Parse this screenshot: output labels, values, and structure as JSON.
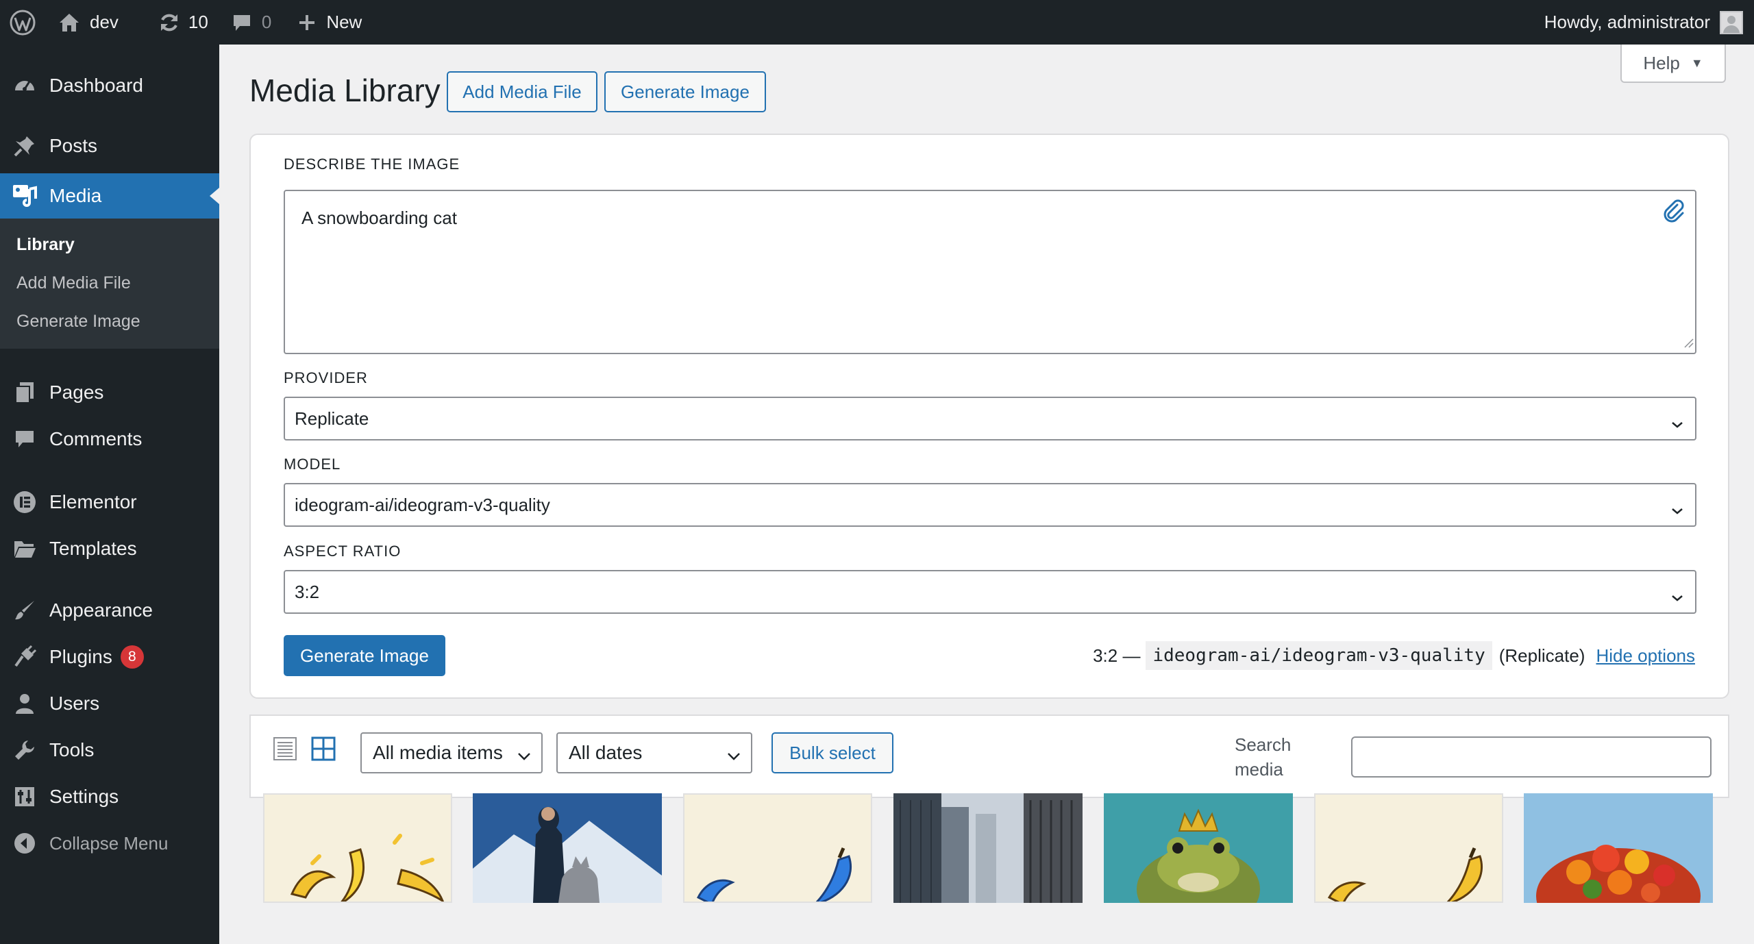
{
  "adminbar": {
    "site_name": "dev",
    "updates_count": "10",
    "comments_count": "0",
    "new_label": "New",
    "greeting": "Howdy, administrator"
  },
  "sidebar": {
    "items": [
      {
        "label": "Dashboard",
        "icon": "dashboard-icon"
      },
      {
        "label": "Posts",
        "icon": "pushpin-icon"
      },
      {
        "label": "Media",
        "icon": "media-icon",
        "current": true
      },
      {
        "label": "Pages",
        "icon": "pages-icon"
      },
      {
        "label": "Comments",
        "icon": "comment-icon"
      },
      {
        "label": "Elementor",
        "icon": "elementor-icon"
      },
      {
        "label": "Templates",
        "icon": "folder-icon"
      },
      {
        "label": "Appearance",
        "icon": "paintbrush-icon"
      },
      {
        "label": "Plugins",
        "icon": "plugin-icon",
        "badge": "8"
      },
      {
        "label": "Users",
        "icon": "user-icon"
      },
      {
        "label": "Tools",
        "icon": "wrench-icon"
      },
      {
        "label": "Settings",
        "icon": "settings-icon"
      }
    ],
    "submenu": [
      "Library",
      "Add Media File",
      "Generate Image"
    ],
    "collapse_label": "Collapse Menu"
  },
  "header": {
    "title": "Media Library",
    "add_media_label": "Add Media File",
    "generate_image_label": "Generate Image",
    "help_label": "Help"
  },
  "generator": {
    "prompt_label": "DESCRIBE THE IMAGE",
    "prompt_value": "A snowboarding cat",
    "provider_label": "PROVIDER",
    "provider_value": "Replicate",
    "model_label": "MODEL",
    "model_value": "ideogram-ai/ideogram-v3-quality",
    "aspect_label": "ASPECT RATIO",
    "aspect_value": "3:2",
    "submit_label": "Generate Image",
    "summary_prefix": "3:2 —",
    "summary_model": "ideogram-ai/ideogram-v3-quality",
    "summary_provider": "(Replicate)",
    "hide_options_label": "Hide options"
  },
  "toolbar": {
    "media_type_filter": "All media items",
    "date_filter": "All dates",
    "bulk_select_label": "Bulk select",
    "search_label": "Search media",
    "search_value": ""
  },
  "colors": {
    "adminbar_bg": "#1d2327",
    "accent": "#2271b1",
    "page_bg": "#f0f0f1",
    "badge": "#d63638"
  }
}
